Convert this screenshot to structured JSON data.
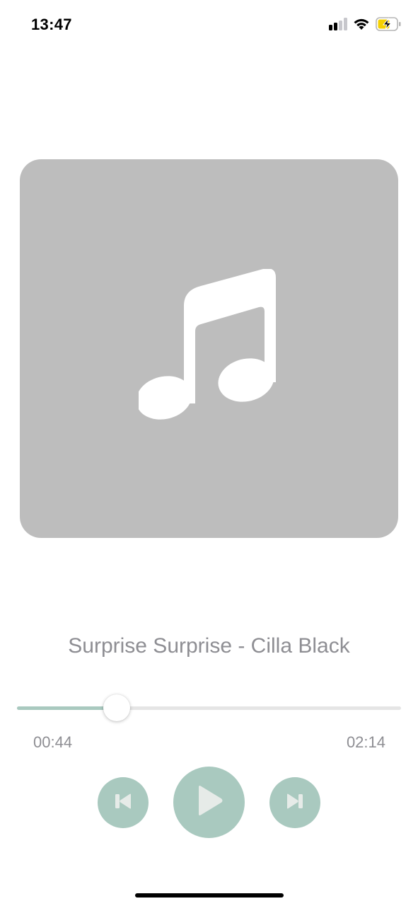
{
  "status_bar": {
    "time": "13:47",
    "icons": [
      "cellular-signal-icon",
      "wifi-icon",
      "battery-charging-icon"
    ]
  },
  "artwork": {
    "placeholder_icon": "music-note-icon",
    "background_color": "#bdbdbd"
  },
  "player": {
    "title": "Surprise Surprise - Cilla Black",
    "elapsed": "00:44",
    "duration": "02:14",
    "progress_fraction": 0.26,
    "accent_color": "#a9c9bf",
    "controls": {
      "previous_icon": "skip-previous-icon",
      "play_icon": "play-icon",
      "next_icon": "skip-next-icon"
    }
  }
}
